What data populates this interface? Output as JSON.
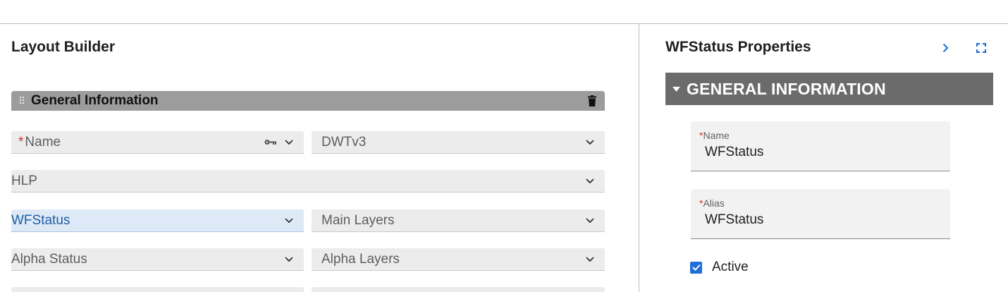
{
  "layout_builder": {
    "title": "Layout Builder",
    "section": {
      "title": "General Information",
      "grip_icon": "drag-grip-icon",
      "delete_icon": "trash-icon"
    },
    "fields": [
      {
        "label": "Name",
        "required": true,
        "has_key_icon": true
      },
      {
        "label": "DWTv3"
      },
      {
        "label": "HLP"
      },
      {
        "label": "WFStatus",
        "selected": true
      },
      {
        "label": "Main Layers"
      },
      {
        "label": "Alpha Status"
      },
      {
        "label": "Alpha Layers"
      },
      {
        "label": ""
      },
      {
        "label": ""
      }
    ]
  },
  "properties": {
    "title": "WFStatus Properties",
    "collapse_icon": "chevron-right-icon",
    "expand_icon": "fullscreen-icon",
    "section_title": "GENERAL INFORMATION",
    "name": {
      "label": "Name",
      "required_marker": "*",
      "value": "WFStatus"
    },
    "alias": {
      "label": "Alias",
      "required_marker": "*",
      "value": "WFStatus"
    },
    "active": {
      "label": "Active",
      "checked": true
    }
  },
  "colors": {
    "accent": "#1e6fd6",
    "required": "#d32f2f",
    "section_bar": "#9c9c9c",
    "section_header": "#6b6b6b",
    "selected_field": "#dde9f6"
  }
}
